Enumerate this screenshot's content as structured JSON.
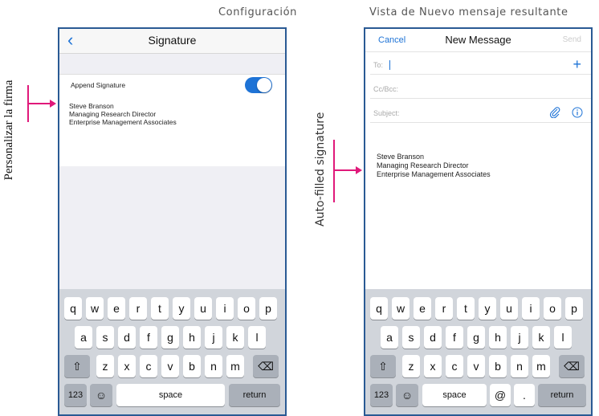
{
  "captions": {
    "left": "Configuración",
    "right": "Vista de Nuevo mensaje resultante"
  },
  "side_labels": {
    "left": "Personalizar la firma",
    "right": "Auto-filled signature"
  },
  "colors": {
    "accent": "#1e73d6",
    "frame": "#2a5a94",
    "pointer": "#e0197a"
  },
  "settings_screen": {
    "title": "Signature",
    "back_icon": "chevron-left-icon",
    "toggle_label": "Append Signature",
    "toggle_on": true,
    "signature": [
      "Steve Branson",
      "Managing Research Director",
      "Enterprise Management Associates"
    ]
  },
  "compose_screen": {
    "cancel": "Cancel",
    "title": "New Message",
    "send": "Send",
    "to_label": "To:",
    "cc_label": "Cc/Bcc:",
    "subject_label": "Subject:",
    "icons": [
      "plus-icon",
      "paperclip-icon",
      "info-icon"
    ],
    "signature": [
      "Steve Branson",
      "Managing Research Director",
      "Enterprise Management Associates"
    ]
  },
  "keyboard_left": {
    "row1": [
      "q",
      "w",
      "e",
      "r",
      "t",
      "y",
      "u",
      "i",
      "o",
      "p"
    ],
    "row2": [
      "a",
      "s",
      "d",
      "f",
      "g",
      "h",
      "j",
      "k",
      "l"
    ],
    "row3": [
      "z",
      "x",
      "c",
      "v",
      "b",
      "n",
      "m"
    ],
    "shift": "⇧",
    "backspace": "⌫",
    "numbers": "123",
    "emoji": "☺",
    "space": "space",
    "return": "return"
  },
  "keyboard_right": {
    "row1": [
      "q",
      "w",
      "e",
      "r",
      "t",
      "y",
      "u",
      "i",
      "o",
      "p"
    ],
    "row2": [
      "a",
      "s",
      "d",
      "f",
      "g",
      "h",
      "j",
      "k",
      "l"
    ],
    "row3": [
      "z",
      "x",
      "c",
      "v",
      "b",
      "n",
      "m"
    ],
    "shift": "⇧",
    "backspace": "⌫",
    "numbers": "123",
    "emoji": "☺",
    "space": "space",
    "at": "@",
    "dot": ".",
    "return": "return"
  }
}
